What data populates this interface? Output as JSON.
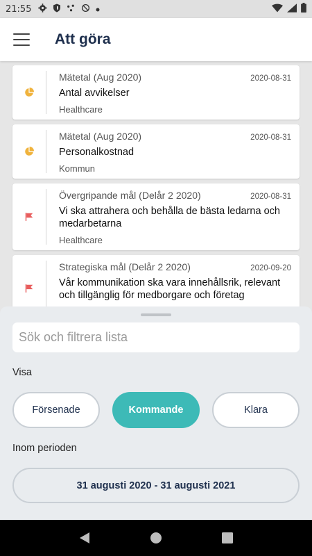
{
  "status_bar": {
    "time": "21:55",
    "icons": [
      "gear-icon",
      "shield-icon",
      "dots-icon",
      "no-sync-icon",
      "dot-icon"
    ],
    "right_icons": [
      "wifi-icon",
      "signal-icon",
      "battery-icon"
    ]
  },
  "app_bar": {
    "menu_icon": "hamburger-menu-icon",
    "title": "Att göra"
  },
  "colors": {
    "accent": "#3dbab7",
    "pie_icon": "#f0b33d",
    "flag_icon": "#e85d5d",
    "title_text": "#1e2f4d"
  },
  "tasks": [
    {
      "icon": "pie-chart-icon",
      "category": "Mätetal (Aug 2020)",
      "date": "2020-08-31",
      "title": "Antal avvikelser",
      "org": "Healthcare"
    },
    {
      "icon": "pie-chart-icon",
      "category": "Mätetal (Aug 2020)",
      "date": "2020-08-31",
      "title": "Personalkostnad",
      "org": "Kommun"
    },
    {
      "icon": "flag-icon",
      "category": "Övergripande mål (Delår 2 2020)",
      "date": "2020-08-31",
      "title": "Vi ska attrahera och behålla de bästa ledarna och medarbetarna",
      "org": "Healthcare"
    },
    {
      "icon": "flag-icon",
      "category": "Strategiska mål (Delår 2 2020)",
      "date": "2020-09-20",
      "title": "Vår kommunikation ska vara innehållsrik, relevant och tillgänglig för medborgare och företag",
      "org": ""
    }
  ],
  "filter": {
    "search_placeholder": "Sök och filtrera lista",
    "show_label": "Visa",
    "options": [
      {
        "label": "Försenade",
        "selected": false
      },
      {
        "label": "Kommande",
        "selected": true
      },
      {
        "label": "Klara",
        "selected": false
      }
    ],
    "period_label": "Inom perioden",
    "period_value": "31 augusti 2020 - 31 augusti 2021"
  },
  "nav_bar": {
    "buttons": [
      "back-icon",
      "home-icon",
      "recents-icon"
    ]
  }
}
